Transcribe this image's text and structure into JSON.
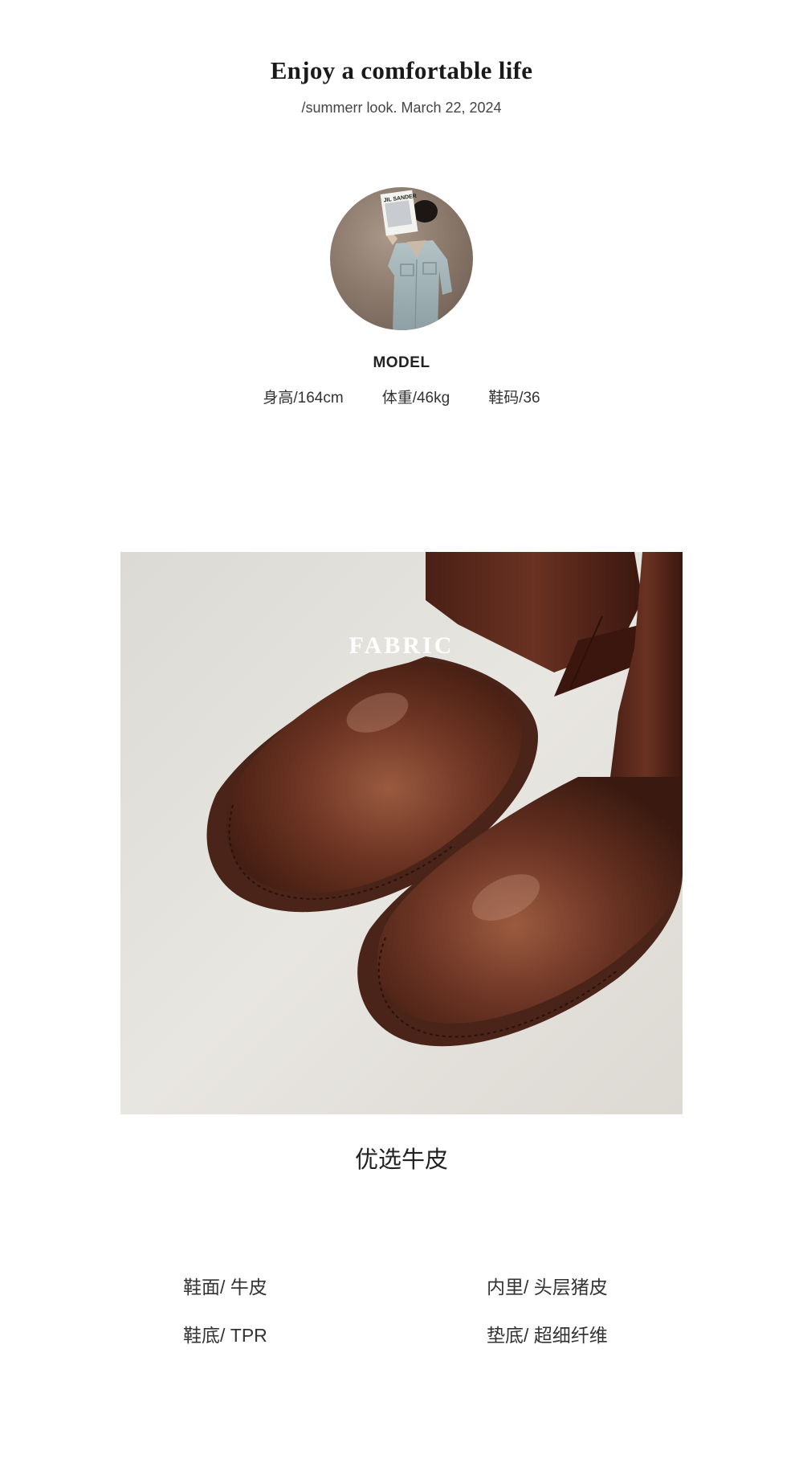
{
  "header": {
    "title": "Enjoy a comfortable life",
    "subtitle": "/summerr look. March 22, 2024"
  },
  "model": {
    "label": "MODEL",
    "height": "身高/164cm",
    "weight": "体重/46kg",
    "shoe_size": "鞋码/36",
    "magazine_text": "JIL SANDER"
  },
  "product_photo": {
    "overlay_label": "FABRIC",
    "caption": "优选牛皮"
  },
  "specs": {
    "upper": "鞋面/ 牛皮",
    "lining": "内里/ 头层猪皮",
    "sole": "鞋底/ TPR",
    "insole": "垫底/ 超细纤维"
  },
  "colors": {
    "leather": "#5a2a1a",
    "leather_highlight": "#8a4a32",
    "background_photo": "#e3e1dc",
    "avatar_bg": "#8c7a6c",
    "denim": "#9fb0b4"
  }
}
